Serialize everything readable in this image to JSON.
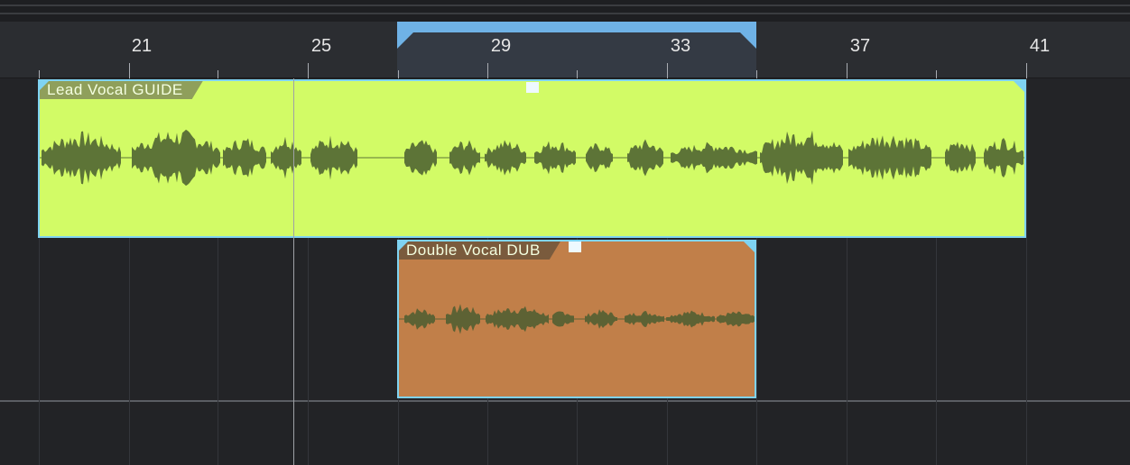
{
  "ruler": {
    "bars": [
      "21",
      "25",
      "29",
      "33",
      "37",
      "41"
    ]
  },
  "loop_range": {
    "start_bar": "27",
    "end_bar": "35",
    "color": "#6fb2e6"
  },
  "tracks": [
    {
      "clip": {
        "title": "Lead Vocal GUIDE",
        "color": "#d2fb66",
        "waveform_color": "#5d7437"
      }
    },
    {
      "clip": {
        "title": "Double Vocal DUB",
        "color": "#c17f49",
        "waveform_color": "#5d6234"
      }
    }
  ],
  "colors": {
    "selection_border": "#7fd3f2",
    "background": "#242528"
  }
}
